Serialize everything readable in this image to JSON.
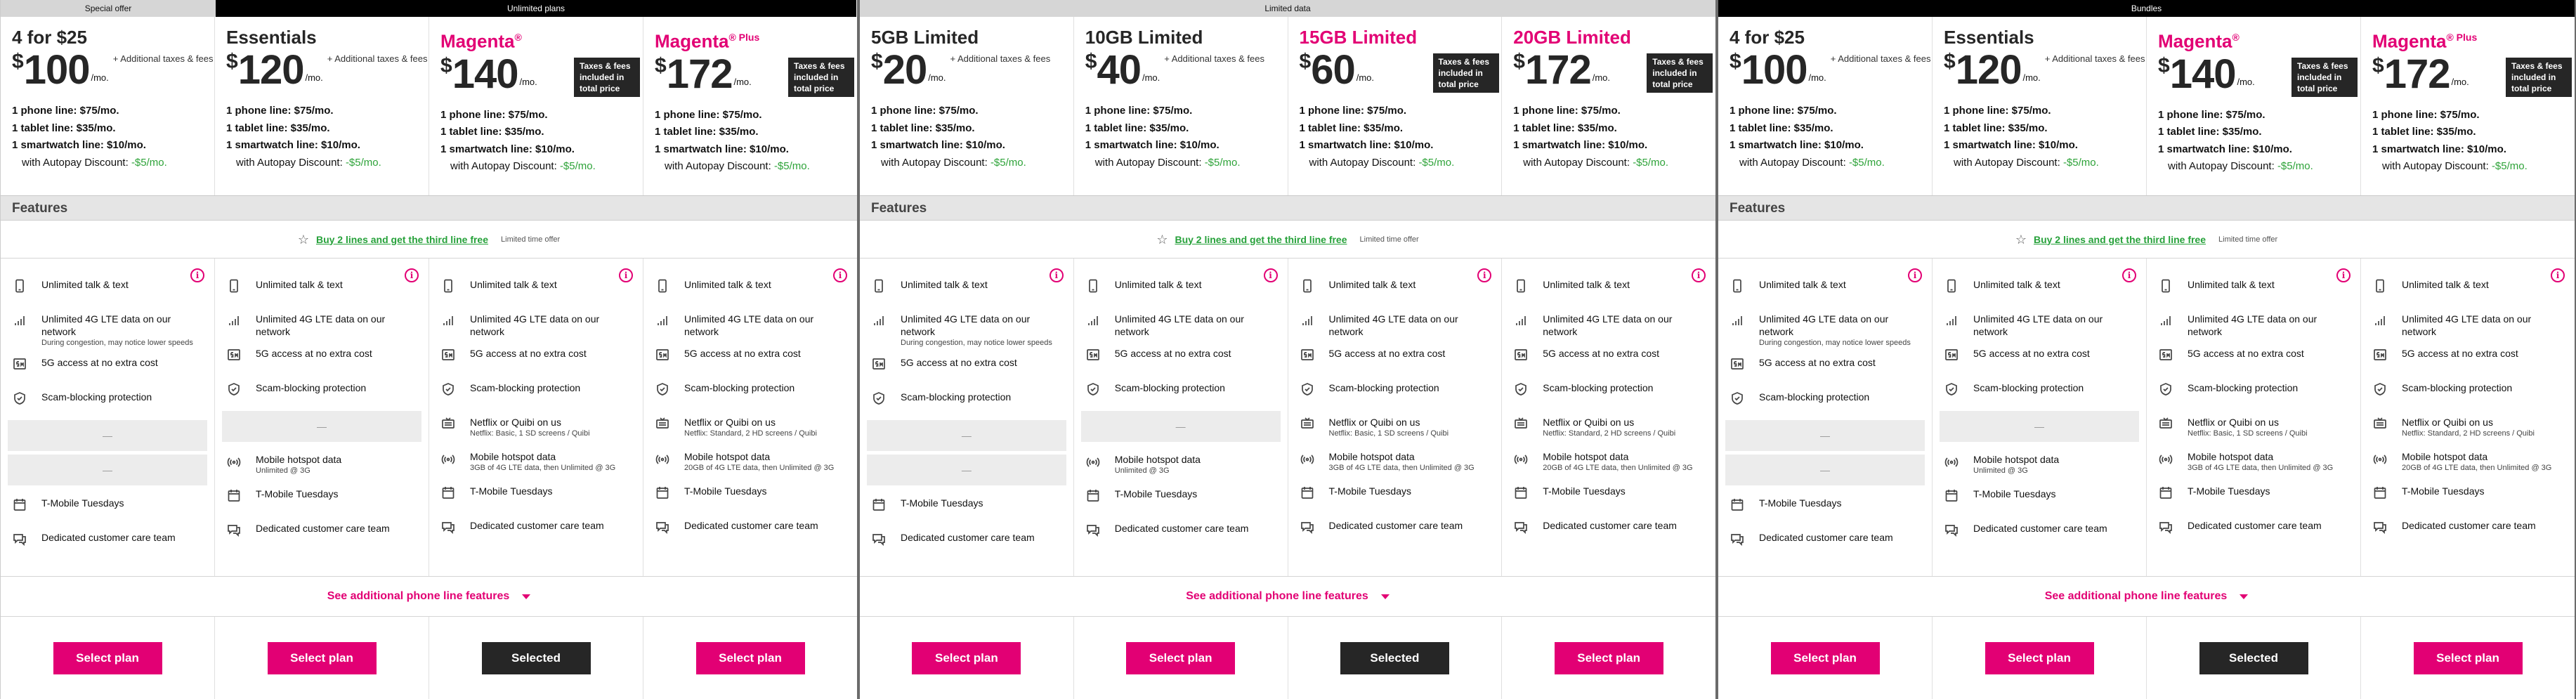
{
  "categories": {
    "special": "Special offer",
    "unlimited": "Unlimited plans",
    "limited": "Limited data",
    "bundles": "Bundles"
  },
  "shared": {
    "features_heading": "Features",
    "offer_link": "Buy 2 lines and get the third line free",
    "offer_note": "Limited time offer",
    "see_more": "See additional phone line features",
    "additional_taxes": "+ Additional taxes & fees",
    "per_month": "/mo.",
    "taxes_included": "Taxes & fees included in total price",
    "autopay_prefix": "with Autopay Discount:",
    "autopay_value": "-$5/mo.",
    "select_label": "Select plan",
    "selected_label": "Selected",
    "empty_slot": "—"
  },
  "lines": {
    "phone": "1 phone line: $75/mo.",
    "tablet": "1 tablet line: $35/mo.",
    "watch": "1 smartwatch line: $10/mo."
  },
  "features": {
    "talk": "Unlimited talk & text",
    "lte": "Unlimited 4G LTE data on our network",
    "lte_sub": "During congestion, may notice lower speeds",
    "fiveg": "5G access at no extra cost",
    "scam": "Scam-blocking protection",
    "netflix": "Netflix or Quibi on us",
    "netflix_basic": "Netflix: Basic, 1 SD screens / Quibi",
    "netflix_std": "Netflix: Standard, 2 HD screens / Quibi",
    "hotspot": "Mobile hotspot data",
    "hotspot_3g": "Unlimited @ 3G",
    "hotspot_3gb": "3GB of 4G LTE data, then Unlimited @ 3G",
    "hotspot_20gb": "20GB of 4G LTE data, then Unlimited @ 3G",
    "tuesdays": "T-Mobile Tuesdays",
    "care": "Dedicated customer care team"
  },
  "plans_a": [
    {
      "name": "4 for $25",
      "sup": "",
      "amount": "100"
    },
    {
      "name": "Essentials",
      "sup": "",
      "amount": "120"
    },
    {
      "name": "Magenta",
      "sup": "®",
      "amount": "140"
    },
    {
      "name": "Magenta",
      "sup": "® Plus",
      "amount": "172"
    }
  ],
  "plans_b": [
    {
      "name": "5GB Limited",
      "amount": "20"
    },
    {
      "name": "10GB Limited",
      "amount": "40"
    },
    {
      "name": "15GB Limited",
      "amount": "60"
    },
    {
      "name": "20GB Limited",
      "amount": "172"
    }
  ],
  "currency": "$",
  "info_glyph": "i",
  "colors": {
    "magenta": "#e20074",
    "green": "#2ea339",
    "dark": "#262626"
  }
}
